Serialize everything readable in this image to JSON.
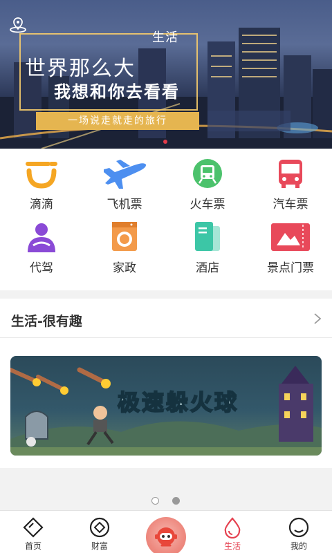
{
  "banner": {
    "title": "生活",
    "slogan_line1": "世界那么大",
    "slogan_line2": "我想和你去看看",
    "tagline": "一场说走就走的旅行"
  },
  "services": [
    {
      "label": "滴滴",
      "icon": "didi-icon",
      "color": "#f5a623"
    },
    {
      "label": "飞机票",
      "icon": "airplane-icon",
      "color": "#4d8ff0"
    },
    {
      "label": "火车票",
      "icon": "train-icon",
      "color": "#4cc26c"
    },
    {
      "label": "汽车票",
      "icon": "bus-icon",
      "color": "#e8495a"
    },
    {
      "label": "代驾",
      "icon": "driver-icon",
      "color": "#8a4ad6"
    },
    {
      "label": "家政",
      "icon": "washing-machine-icon",
      "color": "#f39a4a"
    },
    {
      "label": "酒店",
      "icon": "hotel-icon",
      "color": "#3cc6a6"
    },
    {
      "label": "景点门票",
      "icon": "ticket-icon",
      "color": "#e8495a"
    }
  ],
  "section": {
    "title": "生活-很有趣",
    "game_title": "极速躲火球"
  },
  "pager": {
    "count": 2,
    "active": 2
  },
  "tabbar": {
    "items": [
      {
        "label": "首页",
        "icon": "home-icon"
      },
      {
        "label": "财富",
        "icon": "wealth-icon"
      },
      {
        "label": "",
        "icon": "robot-assistant-icon"
      },
      {
        "label": "生活",
        "icon": "life-drop-icon",
        "active": true
      },
      {
        "label": "我的",
        "icon": "profile-icon"
      }
    ]
  },
  "colors": {
    "accent": "#e5404f",
    "gold": "#e5b550"
  }
}
